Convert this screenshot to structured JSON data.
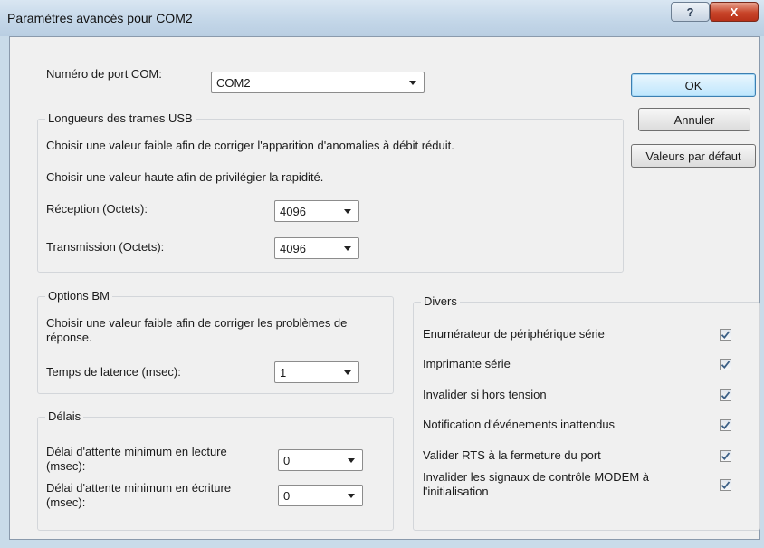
{
  "window": {
    "title": "Paramètres avancés pour COM2",
    "help_label": "?",
    "close_label": "X"
  },
  "port": {
    "label": "Numéro de port COM:",
    "value": "COM2"
  },
  "buttons": {
    "ok": "OK",
    "cancel": "Annuler",
    "defaults": "Valeurs par défaut"
  },
  "usb": {
    "title": "Longueurs des trames USB",
    "hint_low": "Choisir une valeur faible afin de corriger  l'apparition d'anomalies à débit réduit.",
    "hint_high": "Choisir une valeur haute afin de privilégier la rapidité.",
    "rx_label": "Réception (Octets):",
    "rx_value": "4096",
    "tx_label": "Transmission (Octets):",
    "tx_value": "4096"
  },
  "bm": {
    "title": "Options BM",
    "hint": "Choisir une valeur faible afin de corriger les problèmes de réponse.",
    "latency_label": "Temps de latence (msec):",
    "latency_value": "1"
  },
  "delays": {
    "title": "Délais",
    "read_label": "Délai d'attente minimum en lecture (msec):",
    "read_value": "0",
    "write_label": "Délai d'attente minimum en écriture (msec):",
    "write_value": "0"
  },
  "misc": {
    "title": "Divers",
    "items": [
      {
        "label": "Enumérateur de périphérique série",
        "checked": true
      },
      {
        "label": "Imprimante série",
        "checked": true
      },
      {
        "label": "Invalider si hors tension",
        "checked": true
      },
      {
        "label": "Notification d'événements inattendus",
        "checked": true
      },
      {
        "label": "Valider RTS à la fermeture du port",
        "checked": true
      },
      {
        "label": "Invalider les signaux de contrôle MODEM à l'initialisation",
        "checked": true
      }
    ]
  }
}
